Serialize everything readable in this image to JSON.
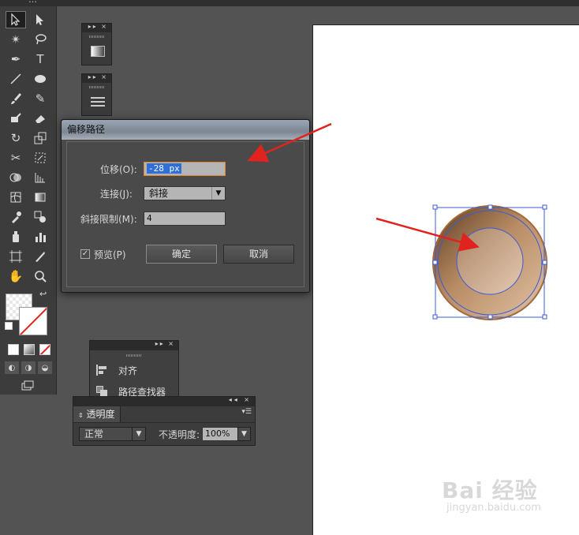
{
  "window": {
    "title_fragment": "…"
  },
  "dialog": {
    "title": "偏移路径",
    "offset_label": "位移(O):",
    "offset_value": "-28 px",
    "joins_label": "连接(J):",
    "joins_value": "斜接",
    "miter_label": "斜接限制(M):",
    "miter_value": "4",
    "preview_label": "预览(P)",
    "preview_checked": true,
    "ok_label": "确定",
    "cancel_label": "取消"
  },
  "align_panel": {
    "items": [
      "对齐",
      "路径查找器"
    ]
  },
  "transparency_panel": {
    "tab_label": "透明度",
    "blend_mode": "正常",
    "opacity_label": "不透明度:",
    "opacity_value": "100%"
  },
  "colors": {
    "accent_arrow": "#e0231e",
    "focus": "#e0862f",
    "selection": "#3b5bd6"
  },
  "watermark": {
    "brand": "Bai 经验",
    "url": "jingyan.baidu.com"
  }
}
